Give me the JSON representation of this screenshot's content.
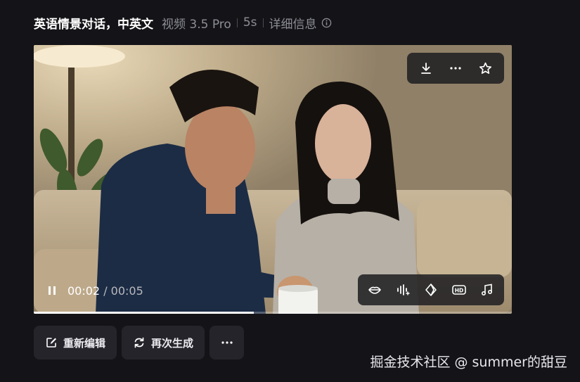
{
  "header": {
    "title": "英语情景对话，中英文",
    "model": "视频 3.5 Pro",
    "duration": "5s",
    "details_label": "详细信息"
  },
  "player": {
    "current_time": "00:02",
    "total_time": "/ 00:05",
    "progress": 0.46,
    "top_icons": [
      "download-icon",
      "more-icon",
      "star-icon"
    ],
    "bottom_icons": [
      "lip-sync-icon",
      "audio-enhance-icon",
      "diamond-icon",
      "hd-icon",
      "music-icon"
    ]
  },
  "actions": {
    "reedit_label": "重新编辑",
    "regenerate_label": "再次生成",
    "more_label": "···"
  },
  "watermark": "掘金技术社区 @ summer的甜豆",
  "colors": {
    "background": "#141418",
    "button": "#24242a",
    "text_muted": "#8d8d96"
  }
}
